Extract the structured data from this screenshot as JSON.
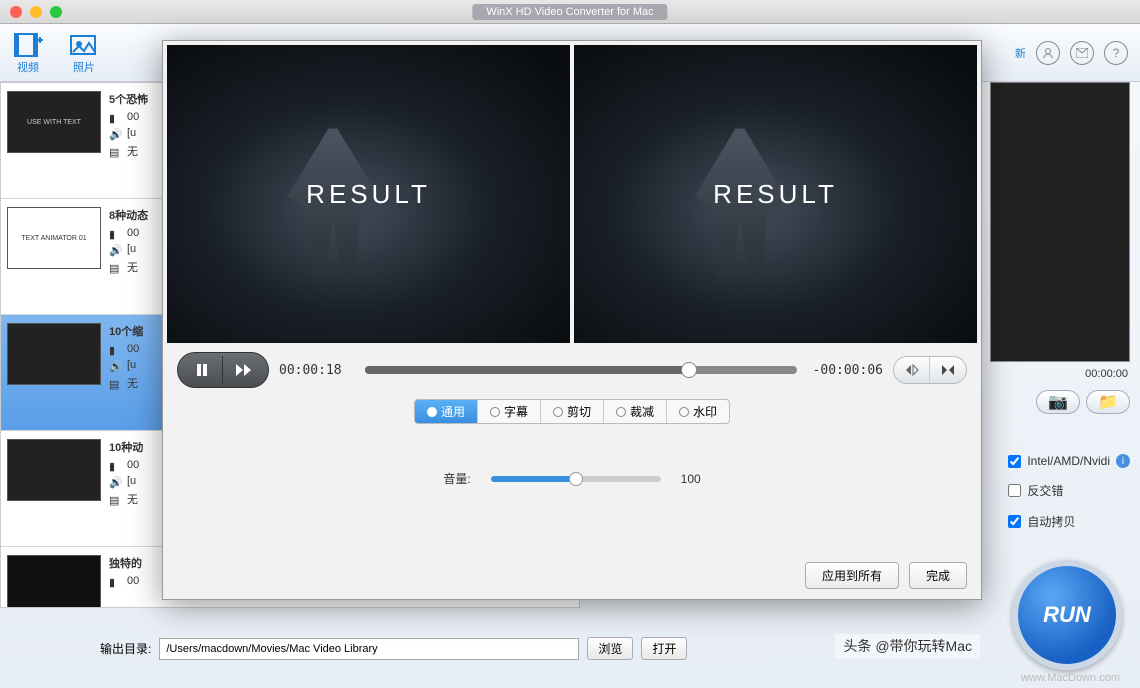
{
  "window": {
    "title": "WinX HD Video Converter for Mac"
  },
  "toolbar": {
    "video": "视频",
    "photo": "照片",
    "right_partial": "新"
  },
  "file_list": [
    {
      "title": "5个恐怖",
      "duration": "00",
      "audio": "[u",
      "subtitle": "无",
      "thumb_text": "USE WITH TEXT"
    },
    {
      "title": "8种动态",
      "duration": "00",
      "audio": "[u",
      "subtitle": "无",
      "thumb_text": "TEXT ANIMATOR 01"
    },
    {
      "title": "10个缩",
      "duration": "00",
      "audio": "[u",
      "subtitle": "无",
      "thumb_text": ""
    },
    {
      "title": "10种动",
      "duration": "00",
      "audio": "[u",
      "subtitle": "无",
      "thumb_text": ""
    },
    {
      "title": "独特的",
      "duration": "00",
      "audio": "",
      "subtitle": "",
      "thumb_text": ""
    }
  ],
  "right_panel": {
    "time": "00:00:00",
    "options": {
      "hwaccel": "Intel/AMD/Nvidi",
      "deinterlace": "反交错",
      "autocopy": "自动拷贝"
    }
  },
  "run_button": "RUN",
  "output": {
    "label": "输出目录:",
    "path": "/Users/macdown/Movies/Mac Video Library",
    "browse": "浏览",
    "open": "打开"
  },
  "watermark": {
    "main": "头条 @带你玩转Mac",
    "sub": "www.MacDown.com"
  },
  "editor": {
    "preview_text": "RESULT",
    "time_current": "00:00:18",
    "time_remaining": "-00:00:06",
    "tabs": {
      "general": "通用",
      "subtitle": "字幕",
      "trim": "剪切",
      "crop": "裁减",
      "watermark": "水印"
    },
    "volume_label": "音量:",
    "volume_value": "100",
    "apply_all": "应用到所有",
    "done": "完成"
  }
}
